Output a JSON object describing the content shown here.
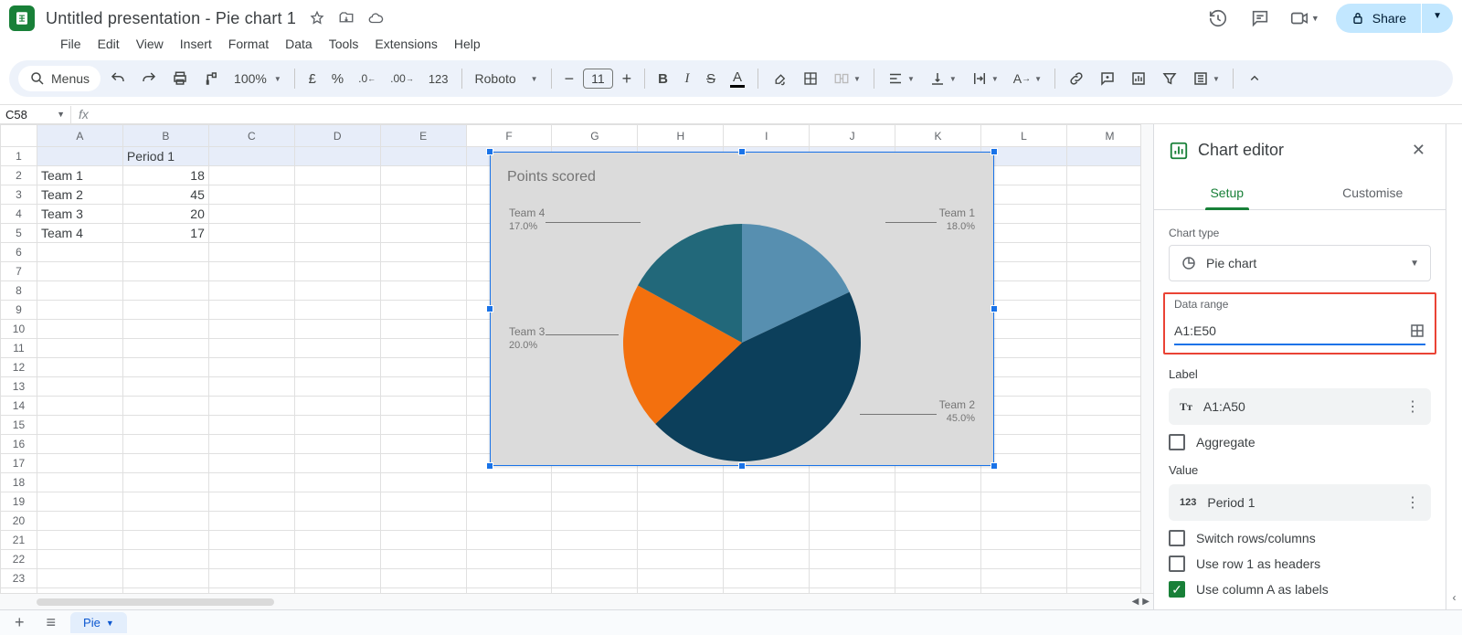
{
  "chart_data": {
    "type": "pie",
    "title": "Points scored",
    "categories": [
      "Team 1",
      "Team 2",
      "Team 3",
      "Team 4"
    ],
    "values": [
      18,
      45,
      20,
      17
    ],
    "percentages": [
      18.0,
      45.0,
      20.0,
      17.0
    ],
    "colors": [
      "#578fb0",
      "#0c3f5b",
      "#f3700e",
      "#22687a"
    ]
  },
  "doc": {
    "title": "Untitled presentation - Pie chart 1"
  },
  "menus": [
    "File",
    "Edit",
    "View",
    "Insert",
    "Format",
    "Data",
    "Tools",
    "Extensions",
    "Help"
  ],
  "toolbar": {
    "menus_label": "Menus",
    "zoom": "100%",
    "font_family": "Roboto",
    "font_size": "11"
  },
  "share_label": "Share",
  "namebox": "C58",
  "columns": [
    "A",
    "B",
    "C",
    "D",
    "E",
    "F",
    "G",
    "H",
    "I",
    "J",
    "K",
    "L",
    "M"
  ],
  "cells": {
    "header": {
      "B1": "Period 1"
    },
    "rows": [
      {
        "A": "Team 1",
        "B": 18
      },
      {
        "A": "Team 2",
        "B": 45
      },
      {
        "A": "Team 3",
        "B": 20
      },
      {
        "A": "Team 4",
        "B": 17
      }
    ]
  },
  "editor": {
    "title": "Chart editor",
    "tabs": {
      "setup": "Setup",
      "customise": "Customise"
    },
    "chart_type_label": "Chart type",
    "chart_type_value": "Pie chart",
    "data_range_label": "Data range",
    "data_range_value": "A1:E50",
    "label_section": "Label",
    "label_value": "A1:A50",
    "aggregate_label": "Aggregate",
    "value_section": "Value",
    "value_value": "Period 1",
    "switch_rows_label": "Switch rows/columns",
    "row1_headers_label": "Use row 1 as headers",
    "colA_labels_label": "Use column A as labels"
  },
  "sheet_tab": "Pie",
  "chart_labels": {
    "t1": "Team 1",
    "p1": "18.0%",
    "t2": "Team 2",
    "p2": "45.0%",
    "t3": "Team 3",
    "p3": "20.0%",
    "t4": "Team 4",
    "p4": "17.0%"
  }
}
